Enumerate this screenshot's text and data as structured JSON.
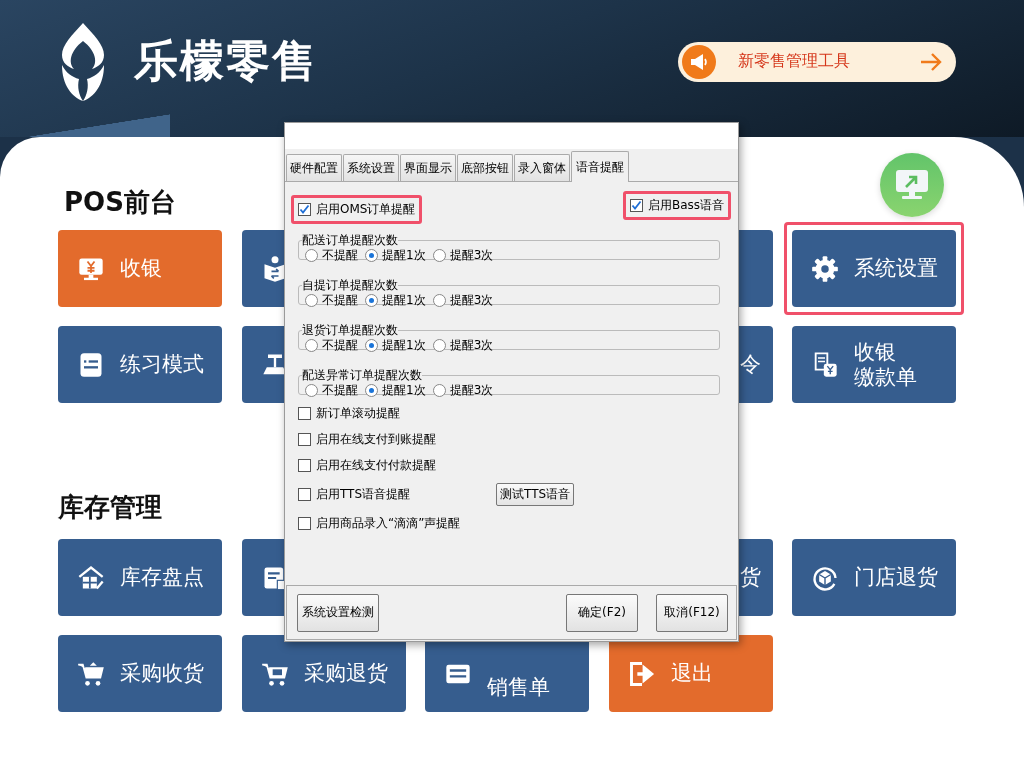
{
  "header": {
    "brand": "乐檬零售",
    "promo": "新零售管理工具"
  },
  "sections": [
    {
      "title": "POS前台",
      "rows": [
        [
          {
            "label": "收银",
            "color": "#e36b2c",
            "highlighted": false
          },
          {
            "color": "#365d8e",
            "highlighted": false
          },
          null,
          {
            "color": "#365d8e",
            "highlighted": false
          },
          {
            "label": "系统设置",
            "color": "#365d8e",
            "highlighted": true
          }
        ],
        [
          {
            "label": "练习模式",
            "color": "#365d8e",
            "highlighted": false
          },
          {
            "color": "#365d8e",
            "highlighted": false
          },
          null,
          {
            "label": "令",
            "color": "#365d8e",
            "highlighted": false
          },
          {
            "label_lines": [
              "收银",
              "缴款单"
            ],
            "color": "#365d8e",
            "highlighted": false
          }
        ]
      ]
    },
    {
      "title": "库存管理",
      "rows": [
        [
          {
            "label": "库存盘点",
            "color": "#365d8e",
            "highlighted": false
          },
          {
            "color": "#365d8e",
            "highlighted": false
          },
          null,
          {
            "label": "货",
            "color": "#365d8e",
            "highlighted": false
          },
          {
            "label": "门店退货",
            "color": "#365d8e",
            "highlighted": false
          }
        ],
        [
          {
            "label": "采购收货",
            "color": "#365d8e",
            "highlighted": false
          },
          {
            "label": "采购退货",
            "color": "#365d8e",
            "highlighted": false
          },
          {
            "label": "销售单",
            "color": "#365d8e",
            "highlighted": false
          },
          {
            "label": "退出",
            "color": "#e36b2c",
            "highlighted": false
          }
        ]
      ]
    }
  ],
  "dialog": {
    "tabs": [
      {
        "label": "硬件配置",
        "selected": false
      },
      {
        "label": "系统设置",
        "selected": false
      },
      {
        "label": "界面显示",
        "selected": false
      },
      {
        "label": "底部按钮",
        "selected": false
      },
      {
        "label": "录入窗体",
        "selected": false
      },
      {
        "label": "语音提醒",
        "selected": true
      }
    ],
    "top_options": [
      {
        "label": "启用OMS订单提醒",
        "checked": true,
        "highlighted": true
      },
      {
        "label": "启用Bass语音",
        "checked": true,
        "highlighted": true
      }
    ],
    "groups": [
      {
        "title": "配送订单提醒次数",
        "options": [
          {
            "label": "不提醒",
            "selected": false
          },
          {
            "label": "提醒1次",
            "selected": true
          },
          {
            "label": "提醒3次",
            "selected": false
          }
        ]
      },
      {
        "title": "自提订单提醒次数",
        "options": [
          {
            "label": "不提醒",
            "selected": false
          },
          {
            "label": "提醒1次",
            "selected": true
          },
          {
            "label": "提醒3次",
            "selected": false
          }
        ]
      },
      {
        "title": "退货订单提醒次数",
        "options": [
          {
            "label": "不提醒",
            "selected": false
          },
          {
            "label": "提醒1次",
            "selected": true
          },
          {
            "label": "提醒3次",
            "selected": false
          }
        ]
      },
      {
        "title": "配送异常订单提醒次数",
        "options": [
          {
            "label": "不提醒",
            "selected": false
          },
          {
            "label": "提醒1次",
            "selected": true
          },
          {
            "label": "提醒3次",
            "selected": false
          }
        ]
      }
    ],
    "options": [
      {
        "label": "新订单滚动提醒",
        "checked": false
      },
      {
        "label": "启用在线支付到账提醒",
        "checked": false
      },
      {
        "label": "启用在线支付付款提醒",
        "checked": false
      },
      {
        "label": "启用TTS语音提醒",
        "checked": false,
        "button": "测试TTS语音"
      },
      {
        "label": "启用商品录入“滴滴”声提醒",
        "checked": false
      }
    ],
    "footer_left": "系统设置检测",
    "footer_buttons": [
      "确定(F2)",
      "取消(F12)"
    ]
  }
}
